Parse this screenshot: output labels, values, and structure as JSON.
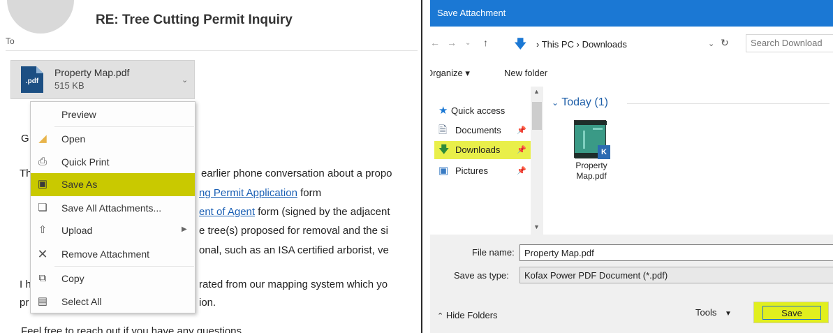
{
  "email": {
    "subject": "RE: Tree Cutting Permit Inquiry",
    "to_label": "To",
    "attachment": {
      "icon_label": ".pdf",
      "name": "Property Map.pdf",
      "size": "515 KB",
      "caret": "⌄"
    },
    "body": {
      "line_greeting": "G",
      "line1_start": "Th",
      "line1_end": "earlier phone conversation about a propo",
      "line2_link": "ng Permit Application",
      "line2_end": " form",
      "line3_link": "ent of Agent",
      "line3_end": " form (signed by the adjacent",
      "line4_end": "e tree(s) proposed for removal and the si",
      "line5_end": "onal, such as an ISA certified arborist, ve",
      "line6_start": "I h",
      "line6_end": "rated from our mapping system which yo",
      "line7_start": "pr",
      "line7_end": "ion.",
      "line8": "Feel free to reach out if you have any questions"
    },
    "context_menu": {
      "items": [
        {
          "label": "Preview",
          "icon": ""
        },
        {
          "label": "Open",
          "icon": "folder-icon"
        },
        {
          "label": "Quick Print",
          "icon": "printer-icon"
        },
        {
          "label": "Save As",
          "icon": "save-icon"
        },
        {
          "label": "Save All Attachments...",
          "icon": "save-all-icon"
        },
        {
          "label": "Upload",
          "icon": "upload-icon"
        },
        {
          "label": "Remove Attachment",
          "icon": "close-icon"
        },
        {
          "label": "Copy",
          "icon": "copy-icon"
        },
        {
          "label": "Select All",
          "icon": "select-all-icon"
        }
      ]
    }
  },
  "dialog": {
    "title": "Save Attachment",
    "address": {
      "path_1": "This PC",
      "separator": "›",
      "path_2": "Downloads"
    },
    "search": {
      "placeholder": "Search Download"
    },
    "toolbar": {
      "organize": "Organize ▾",
      "new_folder": "New folder"
    },
    "nav": {
      "quick_access": "Quick access",
      "documents": "Documents",
      "downloads": "Downloads",
      "pictures": "Pictures"
    },
    "content": {
      "group": "Today (1)",
      "file_line1": "Property",
      "file_line2": "Map.pdf",
      "badge": "K"
    },
    "file_name_label": "File name:",
    "file_name_value": "Property Map.pdf",
    "save_type_label": "Save as type:",
    "save_type_value": "Kofax Power PDF Document (*.pdf)",
    "hide_folders": "Hide Folders",
    "tools": "Tools",
    "save": "Save"
  }
}
